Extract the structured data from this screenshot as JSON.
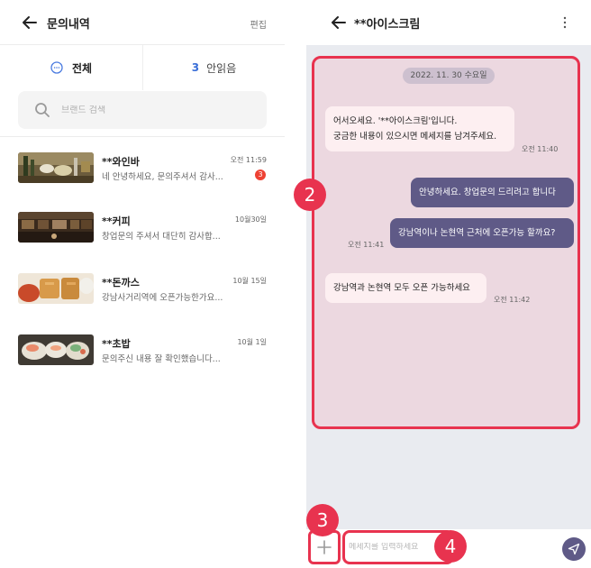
{
  "list_screen": {
    "title": "문의내역",
    "edit_label": "편집",
    "tabs": {
      "all_label": "전체",
      "unread_count": "3",
      "unread_label": "안읽음"
    },
    "search": {
      "placeholder": "브랜드 검색"
    },
    "items": [
      {
        "name": "**와인바",
        "preview": "네 안녕하세요, 문의주셔서 감사...",
        "time": "오전 11:59",
        "badge": "3"
      },
      {
        "name": "**커피",
        "preview": "창업문의 주셔서 대단히 감사합...",
        "time": "10월30일",
        "badge": ""
      },
      {
        "name": "**돈까스",
        "preview": "강남사거리역에 오픈가능한가요...",
        "time": "10월 15일",
        "badge": ""
      },
      {
        "name": "**초밥",
        "preview": "문의주신 내용 잘 확인했습니다...",
        "time": "10월 1일",
        "badge": ""
      }
    ]
  },
  "chat_screen": {
    "title": "**아이스크림",
    "date_label": "2022. 11. 30 수요일",
    "messages": [
      {
        "direction": "in",
        "lines": [
          "어서오세요. '**아이스크림'입니다.",
          "궁금한 내용이 있으시면 메세지를 남겨주세요."
        ],
        "time": "오전 11:40"
      },
      {
        "direction": "out",
        "lines": [
          "안녕하세요. 창업문의 드리려고 합니다"
        ],
        "time": ""
      },
      {
        "direction": "out",
        "lines": [
          "강남역이나 논현역 근처에 오픈가능 할까요?"
        ],
        "time": "오전 11:41"
      },
      {
        "direction": "in",
        "lines": [
          "강남역과 논현역 모두 오픈 가능하세요"
        ],
        "time": "오전 11:42"
      }
    ],
    "input": {
      "placeholder": "메세지를 입력하세요"
    }
  },
  "annotations": {
    "marker_2": "2",
    "marker_3": "3",
    "marker_4": "4"
  },
  "colors": {
    "accent_red": "#e8334f",
    "bubble_out": "#5f5a87",
    "bubble_in": "#fdeff1",
    "unread_blue": "#3a6fd8"
  },
  "icons": [
    "back-arrow-icon",
    "chat-bubble-icon",
    "search-icon",
    "more-vertical-icon",
    "plus-icon",
    "send-icon"
  ]
}
